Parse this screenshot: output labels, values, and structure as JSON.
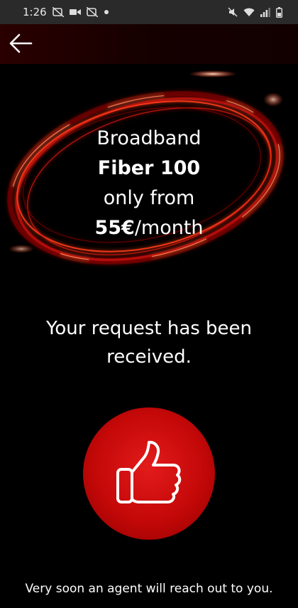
{
  "status_bar": {
    "time": "1:26",
    "left_icons": [
      "notification-muted-icon",
      "video-camera-icon",
      "notification-muted-icon",
      "dot-icon"
    ],
    "right_icons": [
      "mute-icon",
      "wifi-icon",
      "signal-icon",
      "battery-icon"
    ]
  },
  "app_bar": {
    "back_icon": "arrow-left-icon",
    "background": "#1a0000"
  },
  "offer": {
    "line1": "Broadband",
    "line2": "Fiber 100",
    "line3": "only from",
    "price": "55€",
    "price_suffix": "/month"
  },
  "message": "Your request has been received.",
  "thumb_icon": "thumbs-up-icon",
  "footer_text": "Very soon an agent will reach out to you.",
  "colors": {
    "brand_red": "#e60000",
    "background": "#000000"
  }
}
